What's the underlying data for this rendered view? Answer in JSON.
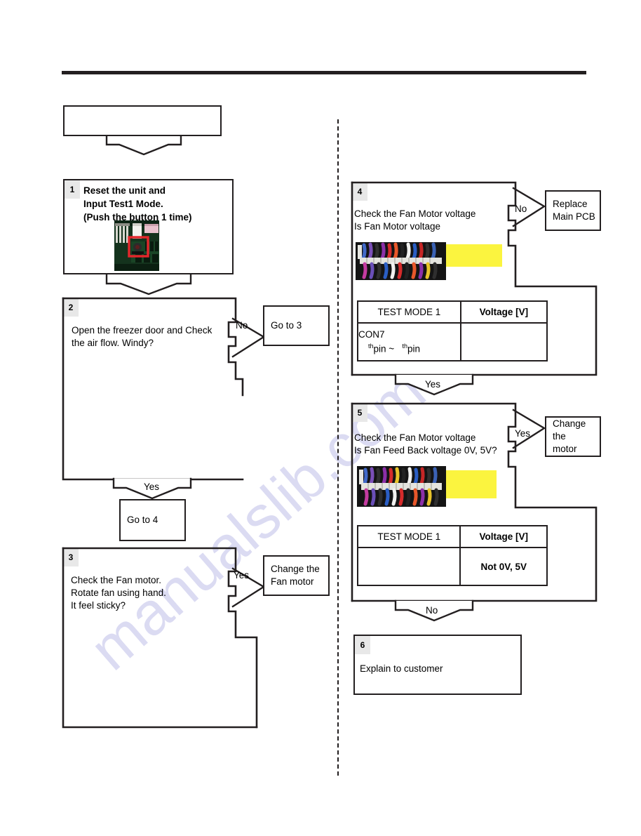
{
  "document": {
    "watermark_text": "manualslib.com"
  },
  "left_column": {
    "top_box": {
      "text": ""
    },
    "step1": {
      "number": "1",
      "text": "Reset the unit and\nInput Test1 Mode.\n(Push the button 1 time)",
      "photo_name": "main-pcb-photo"
    },
    "step2": {
      "number": "2",
      "text": "Open the freezer door and Check\nthe air flow. Windy?",
      "branch_no_label": "No",
      "branch_yes_label": "Yes"
    },
    "goto3": {
      "text": "Go to 3"
    },
    "goto4": {
      "text": "Go to 4"
    },
    "step3": {
      "number": "3",
      "text": "Check the Fan motor.\nRotate fan using hand.\nIt feel sticky?",
      "branch_yes_label": "Yes"
    },
    "change_fan_motor": {
      "text": "Change the\nFan motor"
    }
  },
  "right_column": {
    "step4": {
      "number": "4",
      "text": "Check the Fan Motor voltage\nIs Fan Motor voltage",
      "branch_no_label": "No",
      "branch_yes_label": "Yes",
      "photo_name": "wire-harness-photo",
      "table": {
        "header_left": "TEST MODE 1",
        "header_right": "Voltage [V]",
        "row_left_line1": "CON7",
        "row_left_sup1": "th",
        "row_left_mid": "pin ~",
        "row_left_sup2": "th",
        "row_left_end": "pin",
        "row_right": ""
      }
    },
    "replace_main_pcb": {
      "text": "Replace\nMain PCB"
    },
    "step5": {
      "number": "5",
      "text": "Check the Fan Motor voltage\nIs Fan Feed Back voltage 0V, 5V?",
      "branch_yes_label": "Yes",
      "branch_no_label": "No",
      "photo_name": "wire-harness-photo",
      "table": {
        "header_left": "TEST MODE 1",
        "header_right": "Voltage [V]",
        "row_left": "",
        "row_right": "Not 0V, 5V"
      }
    },
    "change_motor": {
      "text": "Change the\nmotor"
    },
    "step6": {
      "number": "6",
      "text": "Explain to customer"
    }
  },
  "colors": {
    "ink": "#231f20",
    "label_bg": "#e8e8e8",
    "highlight": "#fbf43f",
    "watermark": "#8a8ad6"
  }
}
